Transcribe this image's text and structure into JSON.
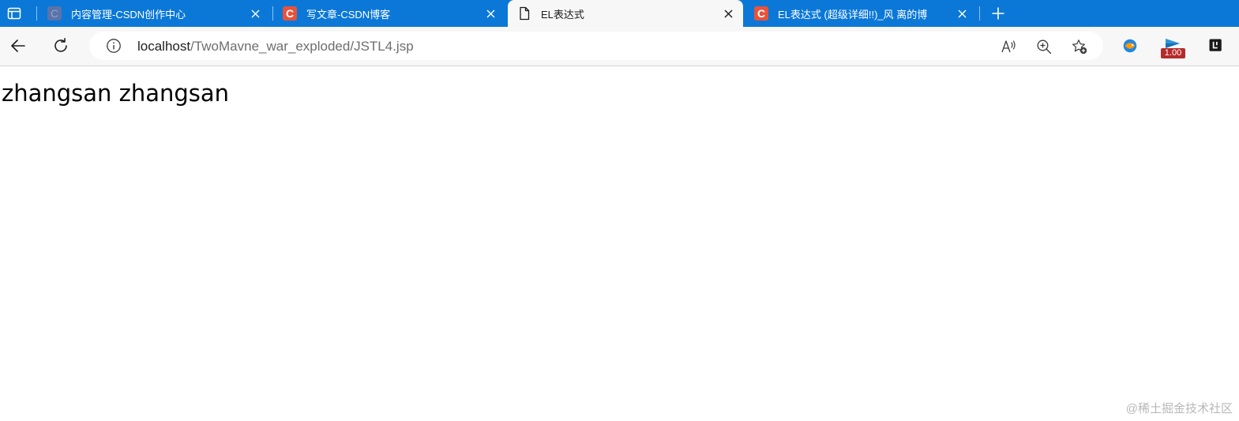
{
  "tabs": [
    {
      "title": "内容管理-CSDN创作中心",
      "favicon": "csdn-c-icon",
      "active": false
    },
    {
      "title": "写文章-CSDN博客",
      "favicon": "csdn-c-icon",
      "active": false
    },
    {
      "title": "EL表达式",
      "favicon": "document-icon",
      "active": true
    },
    {
      "title": "EL表达式 (超级详细!!)_风 离的博",
      "favicon": "csdn-c-icon",
      "active": false
    }
  ],
  "address_bar": {
    "host": "localhost",
    "path": "/TwoMavne_war_exploded/JSTL4.jsp"
  },
  "extensions": {
    "badge_text": "1.00"
  },
  "page": {
    "body_text": "zhangsan zhangsan"
  },
  "watermark": "@稀土掘金技术社区",
  "colors": {
    "tabstrip": "#0b78d8",
    "toolbar": "#f7f7f7",
    "csdn_red": "#e8523b",
    "csdn_faded": "#5a73a8"
  }
}
